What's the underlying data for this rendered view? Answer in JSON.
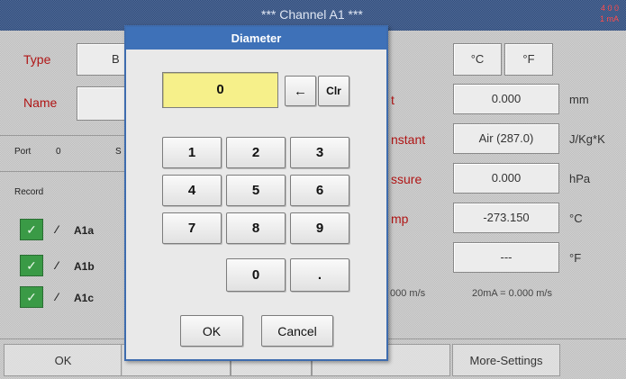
{
  "background": {
    "title": "*** Channel A1 ***",
    "side_line1": "4 0 0",
    "side_line2": "1 mA",
    "type_label": "Type",
    "type_value": "B",
    "name_label": "Name",
    "port_label": "Port",
    "port_value": "0",
    "record_label": "Record",
    "channels": [
      "A1a",
      "A1b",
      "A1c"
    ],
    "unit_c": "°C",
    "unit_f": "°F",
    "right_rows": [
      {
        "label": "t",
        "value": "0.000",
        "unit": "mm"
      },
      {
        "label": "nstant",
        "value": "Air (287.0)",
        "unit": "J/Kg*K"
      },
      {
        "label": "ssure",
        "value": "0.000",
        "unit": "hPa"
      },
      {
        "label": "mp",
        "value": "-273.150",
        "unit": "°C"
      },
      {
        "label": "",
        "value": "---",
        "unit": "°F"
      }
    ],
    "mA_left": "000 m/s",
    "mA_right": "20mA = 0.000 m/s",
    "bottom_ok": "OK",
    "bottom_more": "More-Settings"
  },
  "dialog": {
    "title": "Diameter",
    "display_value": "0",
    "backspace": "←",
    "clear": "Clr",
    "keys": [
      "1",
      "2",
      "3",
      "4",
      "5",
      "6",
      "7",
      "8",
      "9",
      "0",
      "."
    ],
    "ok": "OK",
    "cancel": "Cancel"
  }
}
